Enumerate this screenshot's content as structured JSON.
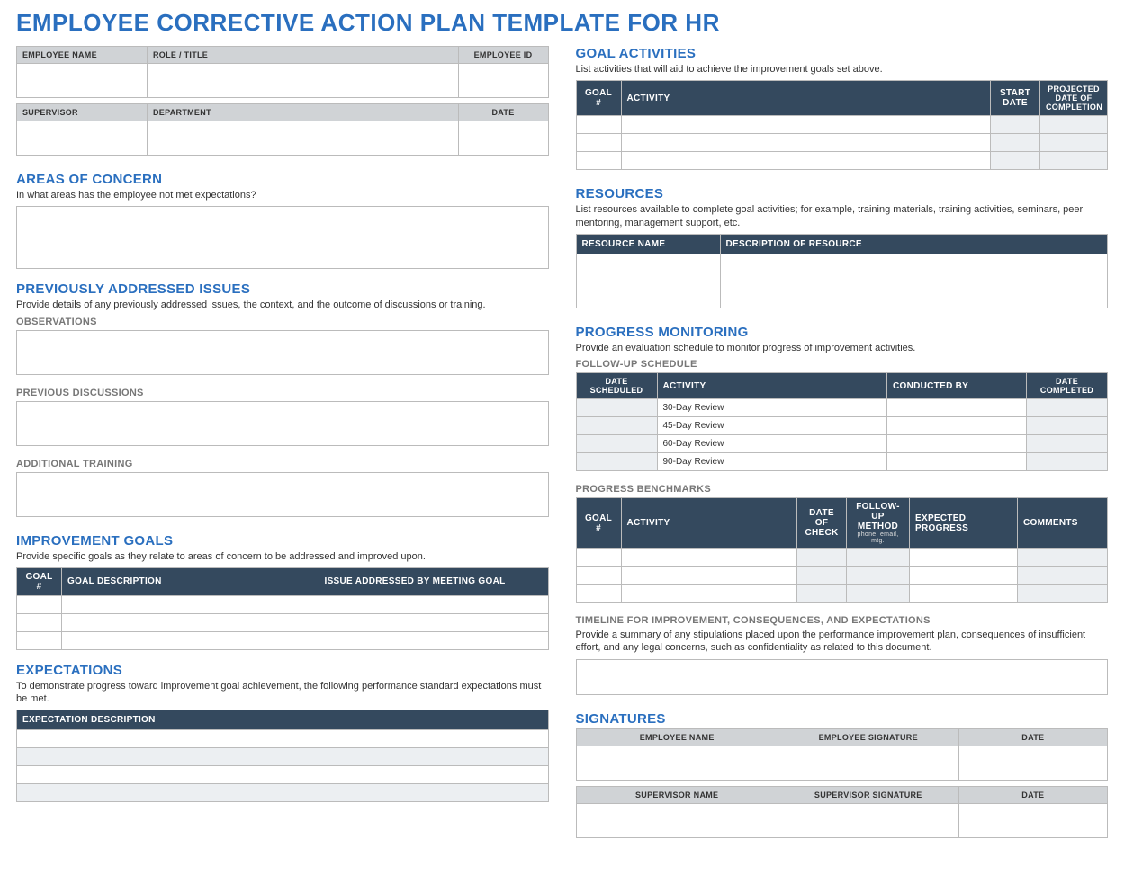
{
  "title": "EMPLOYEE CORRECTIVE ACTION PLAN TEMPLATE FOR HR",
  "left": {
    "emp_info": {
      "h1": "EMPLOYEE NAME",
      "h2": "ROLE / TITLE",
      "h3": "EMPLOYEE ID"
    },
    "sup_info": {
      "h1": "SUPERVISOR",
      "h2": "DEPARTMENT",
      "h3": "DATE"
    },
    "areas": {
      "title": "AREAS OF CONCERN",
      "desc": "In what areas has the employee not met expectations?"
    },
    "prev": {
      "title": "PREVIOUSLY ADDRESSED ISSUES",
      "desc": "Provide details of any previously addressed issues, the context, and the outcome of discussions or training.",
      "obs": "OBSERVATIONS",
      "disc": "PREVIOUS DISCUSSIONS",
      "train": "ADDITIONAL TRAINING"
    },
    "goals": {
      "title": "IMPROVEMENT GOALS",
      "desc": "Provide specific goals as they relate to areas of concern to be addressed and improved upon.",
      "th1": "GOAL #",
      "th2": "GOAL DESCRIPTION",
      "th3": "ISSUE ADDRESSED BY MEETING GOAL"
    },
    "expect": {
      "title": "EXPECTATIONS",
      "desc": "To demonstrate progress toward improvement goal achievement, the following performance standard expectations must be met.",
      "th1": "EXPECTATION DESCRIPTION"
    }
  },
  "right": {
    "activities": {
      "title": "GOAL ACTIVITIES",
      "desc": "List activities that will aid to achieve the improvement goals set above.",
      "th1": "GOAL #",
      "th2": "ACTIVITY",
      "th3": "START DATE",
      "th4": "PROJECTED DATE OF COMPLETION"
    },
    "resources": {
      "title": "RESOURCES",
      "desc": "List resources available to complete goal activities; for example, training materials, training activities, seminars, peer mentoring, management support, etc.",
      "th1": "RESOURCE NAME",
      "th2": "DESCRIPTION OF RESOURCE"
    },
    "monitor": {
      "title": "PROGRESS MONITORING",
      "desc": "Provide an evaluation schedule to monitor progress of improvement activities.",
      "sub1": "FOLLOW-UP SCHEDULE",
      "sched_th1": "DATE SCHEDULED",
      "sched_th2": "ACTIVITY",
      "sched_th3": "CONDUCTED BY",
      "sched_th4": "DATE COMPLETED",
      "r1": "30-Day Review",
      "r2": "45-Day Review",
      "r3": "60-Day Review",
      "r4": "90-Day Review",
      "sub2": "PROGRESS BENCHMARKS",
      "bench_th1": "GOAL #",
      "bench_th2": "ACTIVITY",
      "bench_th3": "DATE OF CHECK",
      "bench_th4": "FOLLOW-UP METHOD",
      "bench_th4_sub": "phone, email, mtg.",
      "bench_th5": "EXPECTED PROGRESS",
      "bench_th6": "COMMENTS",
      "sub3": "TIMELINE FOR IMPROVEMENT, CONSEQUENCES, AND EXPECTATIONS",
      "sub3_desc": "Provide a summary of any stipulations placed upon the performance improvement plan, consequences of insufficient effort, and any legal concerns, such as confidentiality as related to this document."
    },
    "sigs": {
      "title": "SIGNATURES",
      "emp_th1": "EMPLOYEE NAME",
      "emp_th2": "EMPLOYEE SIGNATURE",
      "emp_th3": "DATE",
      "sup_th1": "SUPERVISOR NAME",
      "sup_th2": "SUPERVISOR SIGNATURE",
      "sup_th3": "DATE"
    }
  }
}
